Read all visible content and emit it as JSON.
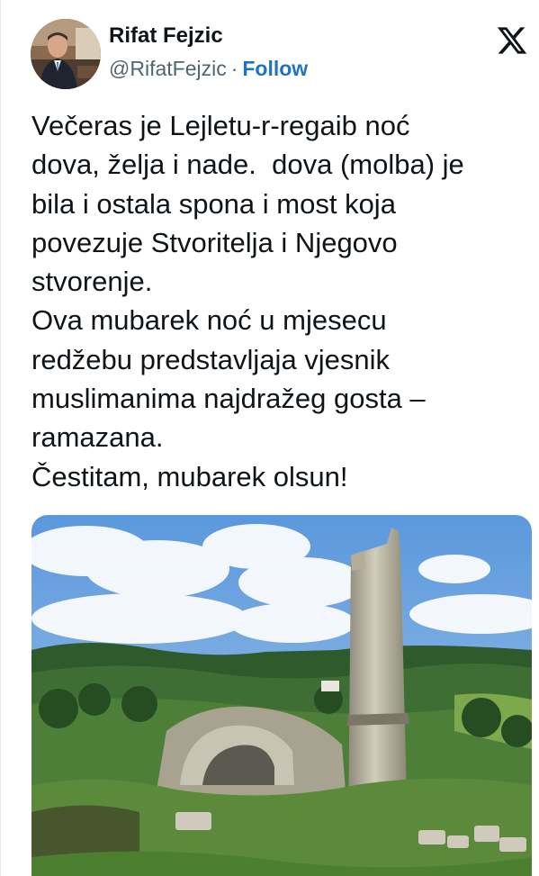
{
  "author": {
    "display_name": "Rifat Fejzic",
    "handle": "@RifatFejzic",
    "separator": "·",
    "follow_label": "Follow"
  },
  "platform_icon": "x-logo-icon",
  "colors": {
    "follow": "#1d74c4",
    "text": "#0f1419",
    "secondary": "#536471",
    "sky": "#6fa6e0"
  },
  "tweet": {
    "text": "Večeras je Lejletu-r-regaib noć\ndova, želja i nade.  dova (molba) je\nbila i ostala spona i most koja\npovezuje Stvoritelja i Njegovo\nstvorenje.\nOva mubarek noć u mjesecu\nredžebu predstavljaja vjesnik\nmuslimanima najdražeg gosta –\nramazana.\nČestitam, mubarek olsun!"
  },
  "media": {
    "icon": "photo-ruined-mosque-minaret"
  }
}
